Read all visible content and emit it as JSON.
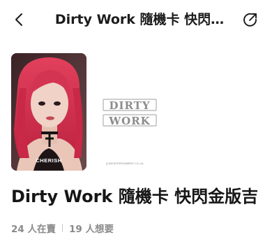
{
  "nav": {
    "title": "Dirty Work 隨機卡 快閃…",
    "back_icon": "chevron-left-icon",
    "share_icon": "share-icon"
  },
  "gallery": {
    "photo_card": {
      "name_label": "CHERISH",
      "subject": "photo of person with pink-red hair"
    },
    "back_card": {
      "logo_text": "DIRTY WORK",
      "copyright": "(C)SM ENTERTAINMENT CO.,Ltd."
    }
  },
  "product": {
    "title": "Dirty Work 隨機卡 快閃金版吉"
  },
  "stats": {
    "selling": "24 人在賣",
    "wanting": "19 人想要"
  },
  "colors": {
    "text_primary": "#1a1a1a",
    "text_secondary": "#8a8a8a",
    "hair": "#d8354f"
  }
}
